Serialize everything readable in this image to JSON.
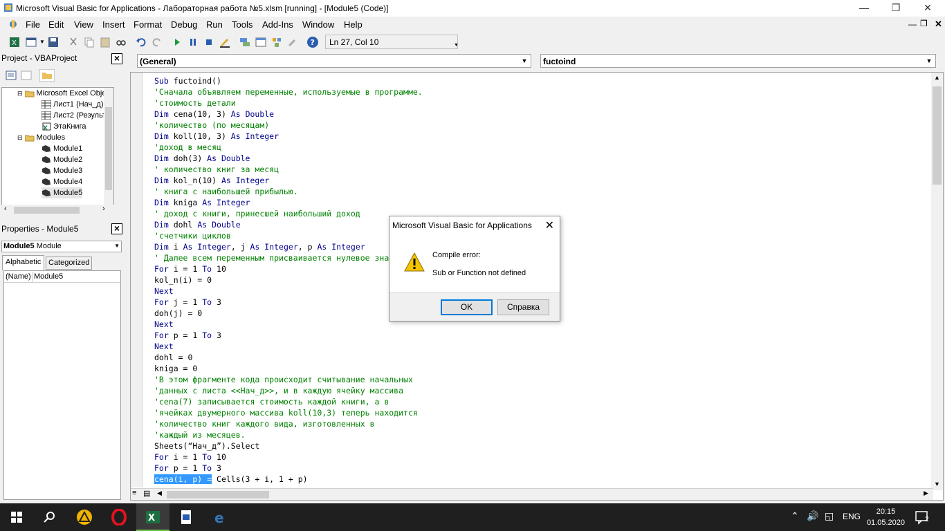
{
  "window": {
    "title": "Microsoft Visual Basic for Applications - Лабораторная работа №5.xlsm [running] - [Module5 (Code)]"
  },
  "menu": [
    "File",
    "Edit",
    "View",
    "Insert",
    "Format",
    "Debug",
    "Run",
    "Tools",
    "Add-Ins",
    "Window",
    "Help"
  ],
  "toolbar": {
    "position": "Ln 27, Col 10"
  },
  "project": {
    "title": "Project - VBAProject",
    "tree": [
      {
        "label": "Microsoft Excel Objec",
        "icon": "folder-open-icon"
      },
      {
        "label": "Лист1 (Нач_д)",
        "icon": "worksheet-icon"
      },
      {
        "label": "Лист2 (Результа",
        "icon": "worksheet-icon"
      },
      {
        "label": "ЭтаКнига",
        "icon": "workbook-icon"
      },
      {
        "label": "Modules",
        "icon": "folder-open-icon"
      },
      {
        "label": "Module1",
        "icon": "module-icon"
      },
      {
        "label": "Module2",
        "icon": "module-icon"
      },
      {
        "label": "Module3",
        "icon": "module-icon"
      },
      {
        "label": "Module4",
        "icon": "module-icon"
      },
      {
        "label": "Module5",
        "icon": "module-icon"
      }
    ]
  },
  "properties": {
    "title": "Properties - Module5",
    "object_name": "Module5",
    "object_type": "Module",
    "tabs": [
      "Alphabetic",
      "Categorized"
    ],
    "rows": [
      {
        "name": "(Name)",
        "value": "Module5"
      }
    ]
  },
  "code": {
    "object_combo": "(General)",
    "proc_combo": "fuctoind",
    "lines": [
      [
        {
          "t": "Sub ",
          "c": "kw"
        },
        {
          "t": "fuctoind()",
          "c": ""
        }
      ],
      [
        {
          "t": "'Сначала объявляем переменные, используемые в программе.",
          "c": "cm"
        }
      ],
      [
        {
          "t": "'стоимость детали",
          "c": "cm"
        }
      ],
      [
        {
          "t": "Dim ",
          "c": "kw"
        },
        {
          "t": "cena(10, 3) ",
          "c": ""
        },
        {
          "t": "As Double",
          "c": "kw"
        }
      ],
      [
        {
          "t": "'количество (по месяцам)",
          "c": "cm"
        }
      ],
      [
        {
          "t": "Dim ",
          "c": "kw"
        },
        {
          "t": "koll(10, 3) ",
          "c": ""
        },
        {
          "t": "As Integer",
          "c": "kw"
        }
      ],
      [
        {
          "t": "'доход в месяц",
          "c": "cm"
        }
      ],
      [
        {
          "t": "Dim ",
          "c": "kw"
        },
        {
          "t": "doh(3) ",
          "c": ""
        },
        {
          "t": "As Double",
          "c": "kw"
        }
      ],
      [
        {
          "t": "' количество книг за месяц",
          "c": "cm"
        }
      ],
      [
        {
          "t": "Dim ",
          "c": "kw"
        },
        {
          "t": "kol_n(10) ",
          "c": ""
        },
        {
          "t": "As Integer",
          "c": "kw"
        }
      ],
      [
        {
          "t": "' книга с наибольшей прибылью.",
          "c": "cm"
        }
      ],
      [
        {
          "t": "Dim ",
          "c": "kw"
        },
        {
          "t": "kniga ",
          "c": ""
        },
        {
          "t": "As Integer",
          "c": "kw"
        }
      ],
      [
        {
          "t": "' доход с книги, принесшей наибольший доход",
          "c": "cm"
        }
      ],
      [
        {
          "t": "Dim ",
          "c": "kw"
        },
        {
          "t": "dohl ",
          "c": ""
        },
        {
          "t": "As Double",
          "c": "kw"
        }
      ],
      [
        {
          "t": "'счетчики циклов",
          "c": "cm"
        }
      ],
      [
        {
          "t": "Dim ",
          "c": "kw"
        },
        {
          "t": "i ",
          "c": ""
        },
        {
          "t": "As Integer",
          "c": "kw"
        },
        {
          "t": ", j ",
          "c": ""
        },
        {
          "t": "As Integer",
          "c": "kw"
        },
        {
          "t": ", p ",
          "c": ""
        },
        {
          "t": "As Integer",
          "c": "kw"
        }
      ],
      [
        {
          "t": "' Далее всем переменным присваивается нулевое значение",
          "c": "cm"
        }
      ],
      [
        {
          "t": "For ",
          "c": "kw"
        },
        {
          "t": "i = 1 ",
          "c": ""
        },
        {
          "t": "To ",
          "c": "kw"
        },
        {
          "t": "10",
          "c": ""
        }
      ],
      [
        {
          "t": "kol_n(i) = 0",
          "c": ""
        }
      ],
      [
        {
          "t": "Next",
          "c": "kw"
        }
      ],
      [
        {
          "t": "For ",
          "c": "kw"
        },
        {
          "t": "j = 1 ",
          "c": ""
        },
        {
          "t": "To ",
          "c": "kw"
        },
        {
          "t": "3",
          "c": ""
        }
      ],
      [
        {
          "t": "doh(j) = 0",
          "c": ""
        }
      ],
      [
        {
          "t": "Next",
          "c": "kw"
        }
      ],
      [
        {
          "t": "For ",
          "c": "kw"
        },
        {
          "t": "p = 1 ",
          "c": ""
        },
        {
          "t": "To ",
          "c": "kw"
        },
        {
          "t": "3",
          "c": ""
        }
      ],
      [
        {
          "t": "Next",
          "c": "kw"
        }
      ],
      [
        {
          "t": "dohl = 0",
          "c": ""
        }
      ],
      [
        {
          "t": "kniga = 0",
          "c": ""
        }
      ],
      [
        {
          "t": "'В этом фрагменте кода происходит считывание начальных",
          "c": "cm"
        }
      ],
      [
        {
          "t": "'данных с листа <<Нач_д>>, и в каждую ячейку массива",
          "c": "cm"
        }
      ],
      [
        {
          "t": "'cena(7) записывается стоимость каждой книги, а в",
          "c": "cm"
        }
      ],
      [
        {
          "t": "'ячейках двумерного массива koll(10,3) теперь находится",
          "c": "cm"
        }
      ],
      [
        {
          "t": "'количество книг каждого вида, изготовленных в",
          "c": "cm"
        }
      ],
      [
        {
          "t": "'каждый из месяцев.",
          "c": "cm"
        }
      ],
      [
        {
          "t": "Sheets(“Нач_д”).Select",
          "c": ""
        }
      ],
      [
        {
          "t": "For ",
          "c": "kw"
        },
        {
          "t": "i = 1 ",
          "c": ""
        },
        {
          "t": "To ",
          "c": "kw"
        },
        {
          "t": "10",
          "c": ""
        }
      ],
      [
        {
          "t": "For ",
          "c": "kw"
        },
        {
          "t": "p = 1 ",
          "c": ""
        },
        {
          "t": "To ",
          "c": "kw"
        },
        {
          "t": "3",
          "c": ""
        }
      ],
      [
        {
          "t": "cena(i, p) =",
          "c": "sel"
        },
        {
          "t": " Cells(3 + i, 1 + p)",
          "c": ""
        }
      ]
    ]
  },
  "dialog": {
    "title": "Microsoft Visual Basic for Applications",
    "heading": "Compile error:",
    "message": "Sub or Function not defined",
    "ok": "OK",
    "help": "Справка"
  },
  "taskbar": {
    "lang": "ENG",
    "time": "20:15",
    "date": "01.05.2020",
    "notifications": "2"
  },
  "colors": {
    "keyword": "#00008b",
    "comment": "#008000",
    "selection": "#3399ff",
    "accent": "#0078d7"
  }
}
